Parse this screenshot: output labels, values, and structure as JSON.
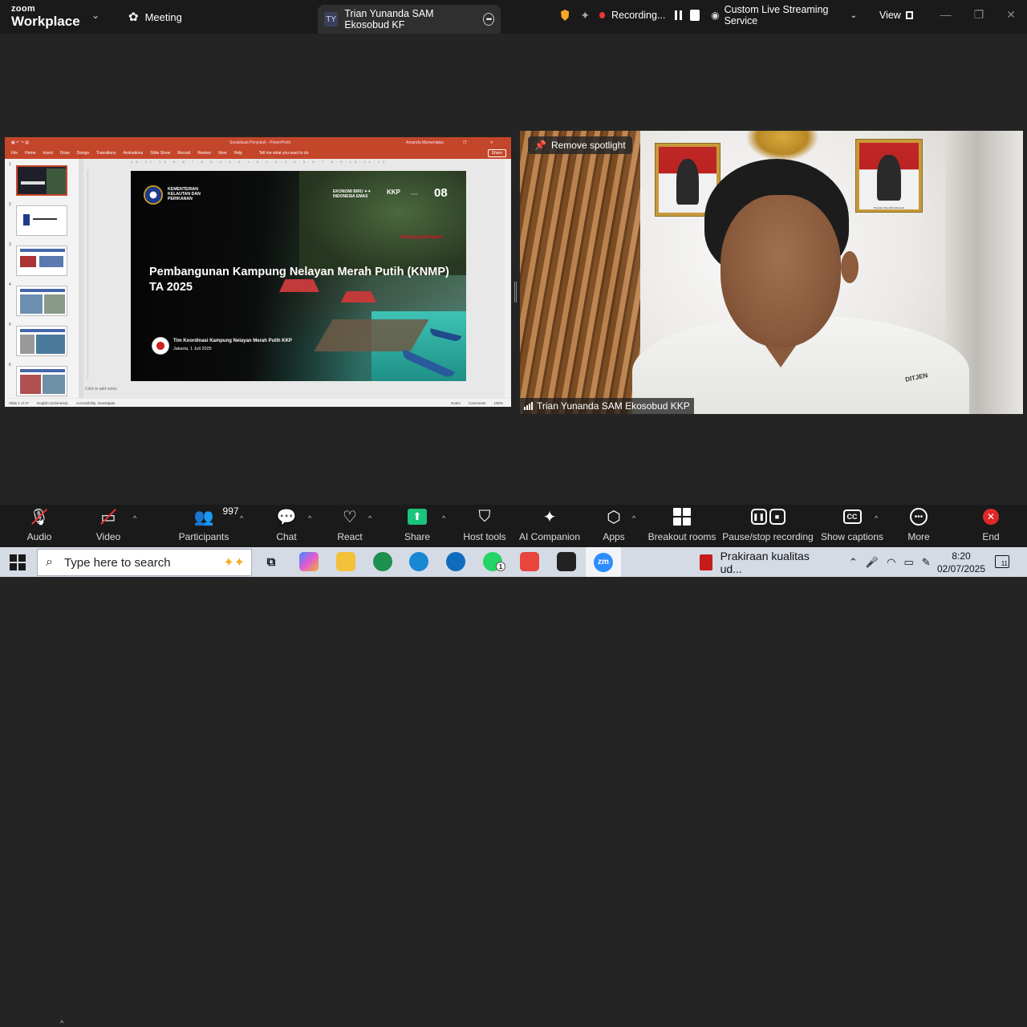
{
  "app": {
    "logo_line1": "zoom",
    "logo_line2": "Workplace",
    "logo_caret": "⌄",
    "meeting_tab": "Meeting",
    "active_tab_initials": "TY",
    "active_tab_title": "Trian Yunanda SAM Ekosobud KF",
    "recording_label": "Recording...",
    "stream_label": "Custom Live Streaming Service",
    "view_label": "View",
    "window_controls": [
      "—",
      "❐",
      "✕"
    ]
  },
  "powerpoint": {
    "file_title": "Sosialisasi Penyuluh  -  PowerPoint",
    "user_name": "Amanda Marwengisa",
    "window_controls": "– ❐ ✕",
    "menu": [
      "File",
      "Home",
      "Insert",
      "Draw",
      "Design",
      "Transitions",
      "Animations",
      "Slide Show",
      "Record",
      "Review",
      "View",
      "Help"
    ],
    "tell_me": "Tell me what you want to do",
    "share_label": "Share",
    "ruler": "12·11·10·9·8·7·6·5·4·3·2·1·0·1·2·3·4·5·6·7·8·9·10·11·12",
    "thumbnail_numbers": [
      "1",
      "2",
      "3",
      "4",
      "5",
      "6"
    ],
    "notes_placeholder": "Click to add notes",
    "status_left": [
      "Slide 1 of 27",
      "English (Indonesia)",
      "Accessibility: Investigate"
    ],
    "status_right": [
      "Notes",
      "Comments",
      "100%"
    ]
  },
  "slide": {
    "org_name": "KEMENTERIAN\nKELAUTAN DAN\nPERIKANAN",
    "eb_text": "EKONOMI BIRU ✦✦\nINDONESIA EMAS",
    "kkp_mark": "KKP",
    "wave_text": "~~~",
    "badge_number": "08",
    "red_text": "Kampung Nelayan",
    "title": "Pembangunan Kampung Nelayan Merah Putih (KNMP) TA 2025",
    "team": "Tim Koordinasi Kampung Nelayan Merah Putih KKP",
    "date": "Jakarta, 1 Juli 2025"
  },
  "video": {
    "spotlight_button": "Remove spotlight",
    "participant_name": "Trian Yunanda SAM Ekosobud KKP",
    "shirt_text": "DITJEN",
    "frame_caption": "Presiden Republik Indonesia"
  },
  "controls": {
    "audio": "Audio",
    "video": "Video",
    "participants": "Participants",
    "participants_count": "997",
    "chat": "Chat",
    "react": "React",
    "share": "Share",
    "host_tools": "Host tools",
    "ai_companion": "AI Companion",
    "apps": "Apps",
    "breakout_rooms": "Breakout rooms",
    "pause_stop_recording": "Pause/stop recording",
    "show_captions": "Show captions",
    "more": "More",
    "end": "End"
  },
  "taskbar": {
    "search_placeholder": "Type here to search",
    "whatsapp_badge": "1",
    "pdf_task": "Prakiraan kualitas ud...",
    "time": "8:20",
    "date": "02/07/2025",
    "notif_count": "11",
    "zoom_label": "zm"
  },
  "colors": {
    "zoom_bg": "#242424",
    "ppt_accent": "#c4462a",
    "share_green": "#1bc47d",
    "end_red": "#e02828",
    "rec_red": "#ee3333"
  }
}
